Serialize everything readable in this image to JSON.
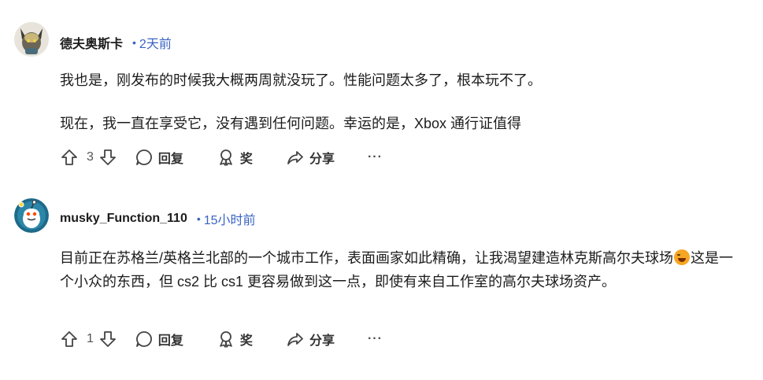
{
  "comments": [
    {
      "username": "德夫奥斯卡",
      "dot": "•",
      "time": "2天前",
      "paragraphs": [
        "我也是，刚发布的时候我大概两周就没玩了。性能问题太多了，根本玩不了。",
        "现在，我一直在享受它，没有遇到任何问题。幸运的是，Xbox 通行证值得"
      ],
      "votes": "3",
      "reply": "回复",
      "award": "奖",
      "share": "分享",
      "more": "···"
    },
    {
      "username": "musky_Function_110",
      "dot": "•",
      "time": "15小时前",
      "text_before_emoji": "目前正在苏格兰/英格兰北部的一个城市工作，表面画家如此精确，让我渴望建造林克斯高尔夫球场",
      "text_after_emoji": "这是一个小众的东西，但 cs2 比 cs1 更容易做到这一点，即使有来自工作室的高尔夫球场资产。",
      "votes": "1",
      "reply": "回复",
      "award": "奖",
      "share": "分享",
      "more": "···"
    }
  ],
  "colors": {
    "accent": "#3a63c4",
    "text": "#1c1c1c",
    "muted": "#4a4a4a"
  },
  "icons": [
    "upvote-icon",
    "downvote-icon",
    "comment-icon",
    "award-icon",
    "share-icon",
    "more-icon",
    "laughing-emoji"
  ]
}
